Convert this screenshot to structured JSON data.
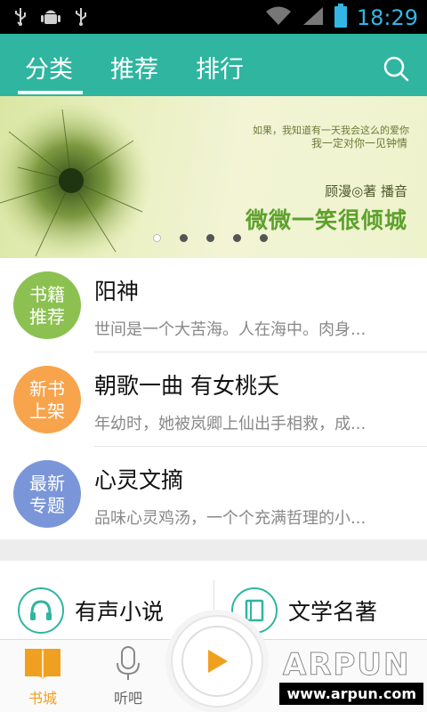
{
  "status_bar": {
    "time": "18:29",
    "icons": [
      "usb-icon",
      "android-debug-icon",
      "usb-icon",
      "wifi-icon",
      "signal-icon",
      "battery-icon"
    ]
  },
  "header": {
    "tabs": [
      {
        "label": "分类",
        "active": true
      },
      {
        "label": "推荐",
        "active": false
      },
      {
        "label": "排行",
        "active": false
      }
    ],
    "search_icon": "search-icon"
  },
  "banner": {
    "small_line1": "如果，我知道有一天我会这么的爱你",
    "small_line2": "我一定对你一见钟情",
    "author": "顾漫◎著  播音",
    "title": "微微一笑很倾城",
    "dots_count": 5,
    "active_dot": 0
  },
  "list": [
    {
      "badge": "书籍\n推荐",
      "badge_color": "#8cc152",
      "title": "阳神",
      "desc": "世间是一个大苦海。人在海中。肉身..."
    },
    {
      "badge": "新书\n上架",
      "badge_color": "#f7a44c",
      "title": "朝歌一曲 有女桃夭",
      "desc": "年幼时，她被岚卿上仙出手相救，成..."
    },
    {
      "badge": "最新\n专题",
      "badge_color": "#7b96d8",
      "title": "心灵文摘",
      "desc": "品味心灵鸡汤，一个个充满哲理的小..."
    }
  ],
  "categories": [
    {
      "label": "有声小说",
      "icon": "headphones-icon"
    },
    {
      "label": "文学名著",
      "icon": "book-icon"
    }
  ],
  "bottom_nav": {
    "items": [
      {
        "label": "书城",
        "icon": "bookstore-icon",
        "active": true
      },
      {
        "label": "听吧",
        "icon": "microphone-icon",
        "active": false
      }
    ],
    "play_icon": "play-icon",
    "watermark": "www.arpun.com",
    "watermark_logo": "ARPUN"
  },
  "colors": {
    "accent": "#2fb5a0",
    "nav_active": "#f0a020",
    "clock": "#33b5e5"
  }
}
